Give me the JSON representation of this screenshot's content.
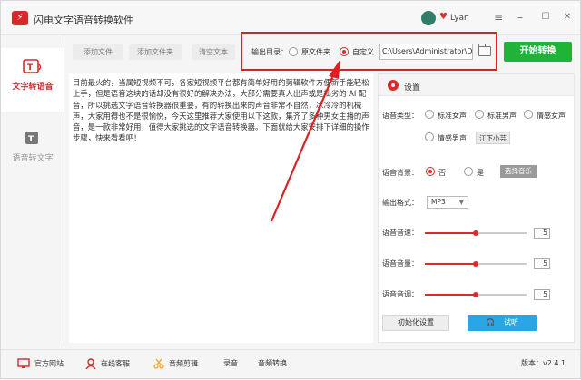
{
  "app": {
    "title": "闪电文字语音转换软件",
    "logo_char": "⚡",
    "username": "Lyan",
    "version_label": "版本：v2.4.1"
  },
  "window_controls": {
    "menu": "≡",
    "minimize": "–",
    "maximize": "☐",
    "close": "✕"
  },
  "sidebar": {
    "items": [
      {
        "label": "文字转语音",
        "active": true
      },
      {
        "label": "语音转文字",
        "active": false
      }
    ]
  },
  "toolbar": {
    "add_file": "添加文件",
    "add_folder": "添加文件夹",
    "clear_text": "清空文本",
    "output_label": "输出目录：",
    "option_original": "原文件夹",
    "option_custom": "自定义",
    "output_path": "C:\\Users\\Administrator\\De",
    "start_button": "开始转换"
  },
  "editor": {
    "text": "目前最火的，当属短视频不可，各家短视频平台都有简单好用的剪辑软件方便新手能轻松上手，但是语音这块的话却没有很好的解决办法，大部分需要真人出声或是拙劣的 AI 配音，所以挑选文字语音转换器很重要，有的转换出来的声音非常不自然，冰冷冷的机械声，大家用得也不是很愉悦，今天这里推荐大家使用以下这款，集齐了多种男女主播的声音，是一款非常好用，值得大家挑选的文字语音转换器。下面就给大家安排下详细的操作步骤，快来看看吧！"
  },
  "settings": {
    "title": "设置",
    "voice_type_label": "语音类型：",
    "voice_options": [
      "标准女声",
      "标准男声",
      "情感女声",
      "情感男声"
    ],
    "voice_selected_tag": "江下小芸",
    "background_label": "语音背景：",
    "background_no": "否",
    "background_yes": "是",
    "choose_music": "选择音乐",
    "format_label": "输出格式：",
    "format_value": "MP3",
    "speed_label": "语音音速：",
    "speed_value": "5",
    "speed_level": 0.5,
    "volume_label": "语音音量：",
    "volume_value": "5",
    "volume_level": 0.5,
    "pitch_label": "语音音调：",
    "pitch_value": "5",
    "pitch_level": 0.5,
    "init_button": "初始化设置",
    "listen_button": "试听"
  },
  "footer": {
    "official_site": "官方网站",
    "online_service": "在线客服",
    "audio_edit": "音频剪辑",
    "record": "录音",
    "audio_convert": "音频转换"
  },
  "colors": {
    "accent_red": "#d72a2a",
    "start_green": "#1fb33a",
    "listen_blue": "#28a6e6"
  }
}
